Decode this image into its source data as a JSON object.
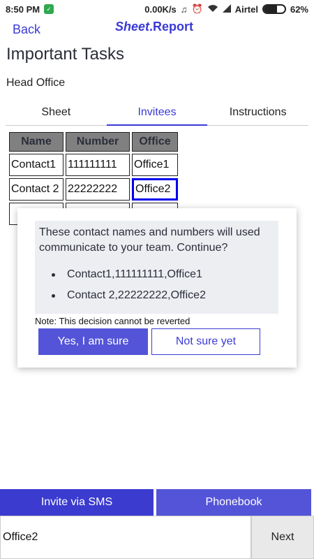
{
  "status_bar": {
    "time": "8:50 PM",
    "network_speed": "0.00K/s",
    "carrier": "Airtel",
    "battery": "62%",
    "battery_level": 0.62,
    "icons": [
      "shield-icon",
      "headphones-icon",
      "alarm-off-icon",
      "wifi-icon",
      "signal-icon",
      "battery-icon"
    ]
  },
  "header": {
    "back_label": "Back",
    "brand_italic": "Sheet",
    "brand_rest": ".Report",
    "title": "Important Tasks",
    "subtitle": "Head Office"
  },
  "tabs": [
    {
      "label": "Sheet",
      "active": false
    },
    {
      "label": "Invitees",
      "active": true
    },
    {
      "label": "Instructions",
      "active": false
    }
  ],
  "table": {
    "headers": [
      "Name",
      "Number",
      "Office"
    ],
    "rows": [
      [
        "Contact1",
        "111111111",
        "Office1"
      ],
      [
        "Contact 2",
        "22222222",
        "Office2"
      ]
    ],
    "selected_cell": "Office2"
  },
  "dialog": {
    "message": "These contact names and numbers will used communicate to your team. Continue?",
    "items": [
      "Contact1,111111111,Office1",
      "Contact 2,22222222,Office2"
    ],
    "note": "Note: This decision cannot be reverted",
    "confirm_label": "Yes, I am sure",
    "cancel_label": "Not sure yet"
  },
  "actions": {
    "sms_label": "Invite via SMS",
    "phonebook_label": "Phonebook",
    "input_value": "Office2",
    "next_label": "Next"
  },
  "colors": {
    "accent": "#3a3ad6",
    "button_primary": "#5454d8",
    "header_gray": "#808080",
    "selected_border": "#0000ee"
  }
}
